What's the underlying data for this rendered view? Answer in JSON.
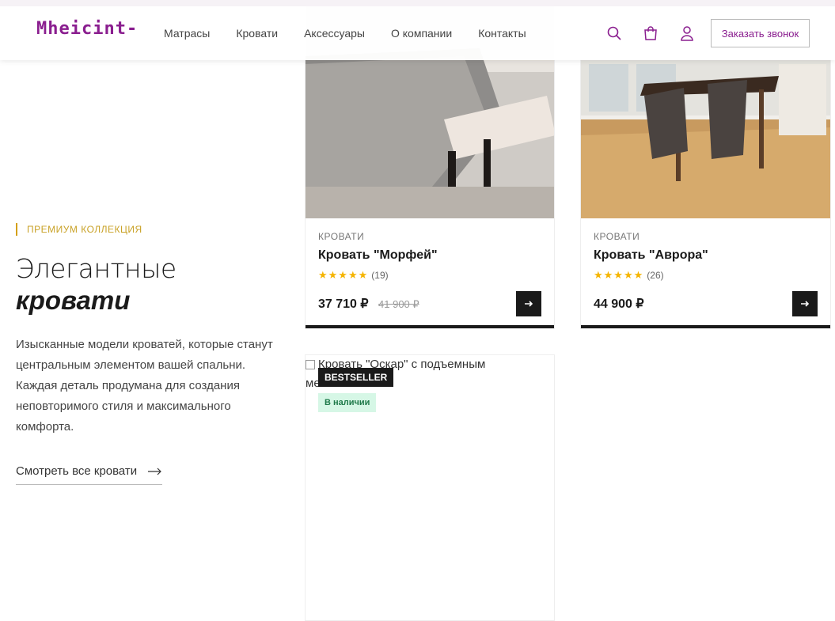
{
  "header": {
    "logo": "Mheicint-",
    "nav": [
      "Матрасы",
      "Кровати",
      "Аксессуары",
      "О компании",
      "Контакты"
    ],
    "call_button": "Заказать звонок"
  },
  "intro": {
    "eyebrow": "ПРЕМИУМ КОЛЛЕКЦИЯ",
    "title_light": "Элегантные",
    "title_bold": "кровати",
    "text": "Изысканные модели кроватей, которые станут центральным элементом вашей спальни. Каждая деталь продумана для создания неповторимого стиля и максимального комфорта.",
    "link": "Смотреть все кровати"
  },
  "products": [
    {
      "category": "КРОВАТИ",
      "name": "Кровать \"Морфей\"",
      "stars": "★★★★★",
      "reviews": "(19)",
      "price": "37 710 ₽",
      "old_price": "41 900 ₽"
    },
    {
      "category": "КРОВАТИ",
      "name": "Кровать \"Аврора\"",
      "stars": "★★★★★",
      "reviews": "(26)",
      "price": "44 900 ₽"
    },
    {
      "image_alt": "Кровать \"Оскар\" с подъемным механизмом",
      "badge": "BESTSELLER",
      "stock": "В наличии"
    }
  ],
  "colors": {
    "brand": "#8a1e8f",
    "accent_gold": "#c9a227",
    "dark": "#1a1a1a",
    "stock_bg": "#d6f7e6"
  }
}
